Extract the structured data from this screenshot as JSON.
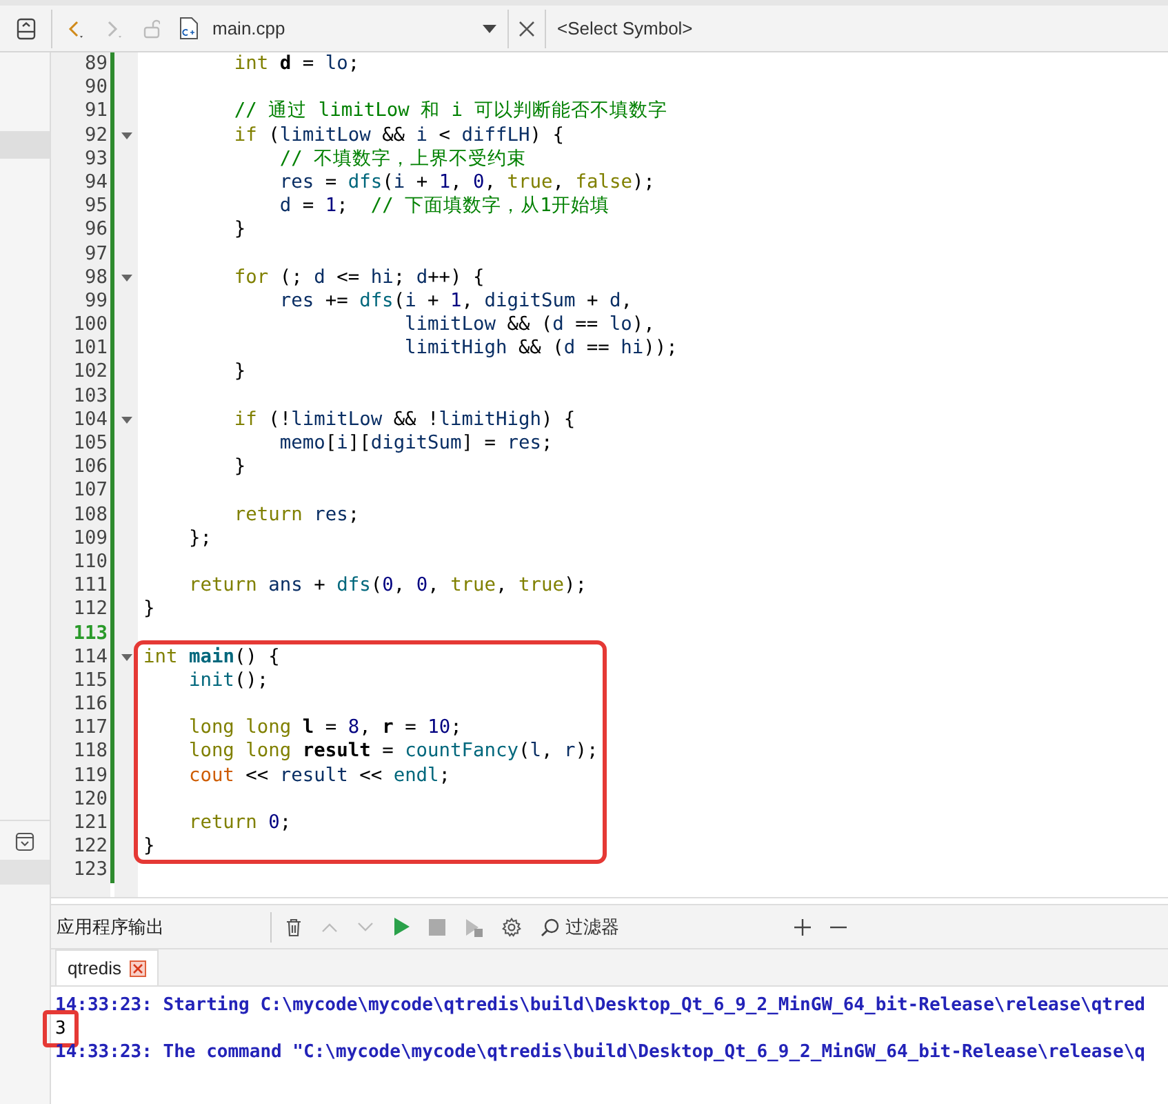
{
  "toolbar": {
    "file_name": "main.cpp",
    "symbol_placeholder": "<Select Symbol>"
  },
  "editor": {
    "lines": [
      {
        "number": "89",
        "fold": false,
        "current": false,
        "boxed": false,
        "tokens": [
          {
            "kind": "kw",
            "text": "        int "
          },
          {
            "kind": "bold",
            "text": "d"
          },
          {
            "kind": "p",
            "text": " = "
          },
          {
            "kind": "id",
            "text": "lo"
          },
          {
            "kind": "p",
            "text": ";"
          }
        ]
      },
      {
        "number": "90",
        "fold": false,
        "current": false,
        "boxed": false
      },
      {
        "number": "91",
        "fold": false,
        "current": false,
        "boxed": false,
        "tokens": [
          {
            "kind": "cmt",
            "text": "        // 通过 limitLow 和 i 可以判断能否不填数字"
          }
        ]
      },
      {
        "number": "92",
        "fold": true,
        "current": false,
        "boxed": false,
        "tokens": [
          {
            "kind": "kw",
            "text": "        if"
          },
          {
            "kind": "p",
            "text": " ("
          },
          {
            "kind": "id",
            "text": "limitLow"
          },
          {
            "kind": "p",
            "text": " && "
          },
          {
            "kind": "id",
            "text": "i"
          },
          {
            "kind": "p",
            "text": " < "
          },
          {
            "kind": "id",
            "text": "diffLH"
          },
          {
            "kind": "p",
            "text": ") {"
          }
        ]
      },
      {
        "number": "93",
        "fold": false,
        "current": false,
        "boxed": false,
        "tokens": [
          {
            "kind": "cmt",
            "text": "            // 不填数字，上界不受约束"
          }
        ]
      },
      {
        "number": "94",
        "fold": false,
        "current": false,
        "boxed": false,
        "tokens": [
          {
            "kind": "id",
            "text": "            res"
          },
          {
            "kind": "p",
            "text": " = "
          },
          {
            "kind": "fn",
            "text": "dfs"
          },
          {
            "kind": "p",
            "text": "("
          },
          {
            "kind": "id",
            "text": "i"
          },
          {
            "kind": "p",
            "text": " + "
          },
          {
            "kind": "num",
            "text": "1"
          },
          {
            "kind": "p",
            "text": ", "
          },
          {
            "kind": "num",
            "text": "0"
          },
          {
            "kind": "p",
            "text": ", "
          },
          {
            "kind": "kw",
            "text": "true"
          },
          {
            "kind": "p",
            "text": ", "
          },
          {
            "kind": "kw",
            "text": "false"
          },
          {
            "kind": "p",
            "text": ");"
          }
        ]
      },
      {
        "number": "95",
        "fold": false,
        "current": false,
        "boxed": false,
        "tokens": [
          {
            "kind": "id",
            "text": "            d"
          },
          {
            "kind": "p",
            "text": " = "
          },
          {
            "kind": "num",
            "text": "1"
          },
          {
            "kind": "p",
            "text": ";  "
          },
          {
            "kind": "cmt",
            "text": "// 下面填数字，从1开始填"
          }
        ]
      },
      {
        "number": "96",
        "fold": false,
        "current": false,
        "boxed": false,
        "tokens": [
          {
            "kind": "p",
            "text": "        }"
          }
        ]
      },
      {
        "number": "97",
        "fold": false,
        "current": false,
        "boxed": false
      },
      {
        "number": "98",
        "fold": true,
        "current": false,
        "boxed": false,
        "tokens": [
          {
            "kind": "kw",
            "text": "        for"
          },
          {
            "kind": "p",
            "text": " (; "
          },
          {
            "kind": "id",
            "text": "d"
          },
          {
            "kind": "p",
            "text": " <= "
          },
          {
            "kind": "id",
            "text": "hi"
          },
          {
            "kind": "p",
            "text": "; "
          },
          {
            "kind": "id",
            "text": "d"
          },
          {
            "kind": "p",
            "text": "++) {"
          }
        ]
      },
      {
        "number": "99",
        "fold": false,
        "current": false,
        "boxed": false,
        "tokens": [
          {
            "kind": "id",
            "text": "            res"
          },
          {
            "kind": "p",
            "text": " += "
          },
          {
            "kind": "fn",
            "text": "dfs"
          },
          {
            "kind": "p",
            "text": "("
          },
          {
            "kind": "id",
            "text": "i"
          },
          {
            "kind": "p",
            "text": " + "
          },
          {
            "kind": "num",
            "text": "1"
          },
          {
            "kind": "p",
            "text": ", "
          },
          {
            "kind": "id",
            "text": "digitSum"
          },
          {
            "kind": "p",
            "text": " + "
          },
          {
            "kind": "id",
            "text": "d"
          },
          {
            "kind": "p",
            "text": ","
          }
        ]
      },
      {
        "number": "100",
        "fold": false,
        "current": false,
        "boxed": false,
        "tokens": [
          {
            "kind": "id",
            "text": "                       limitLow"
          },
          {
            "kind": "p",
            "text": " && ("
          },
          {
            "kind": "id",
            "text": "d"
          },
          {
            "kind": "p",
            "text": " == "
          },
          {
            "kind": "id",
            "text": "lo"
          },
          {
            "kind": "p",
            "text": "),"
          }
        ]
      },
      {
        "number": "101",
        "fold": false,
        "current": false,
        "boxed": false,
        "tokens": [
          {
            "kind": "id",
            "text": "                       limitHigh"
          },
          {
            "kind": "p",
            "text": " && ("
          },
          {
            "kind": "id",
            "text": "d"
          },
          {
            "kind": "p",
            "text": " == "
          },
          {
            "kind": "id",
            "text": "hi"
          },
          {
            "kind": "p",
            "text": "));"
          }
        ]
      },
      {
        "number": "102",
        "fold": false,
        "current": false,
        "boxed": false,
        "tokens": [
          {
            "kind": "p",
            "text": "        }"
          }
        ]
      },
      {
        "number": "103",
        "fold": false,
        "current": false,
        "boxed": false
      },
      {
        "number": "104",
        "fold": true,
        "current": false,
        "boxed": false,
        "tokens": [
          {
            "kind": "kw",
            "text": "        if"
          },
          {
            "kind": "p",
            "text": " (!"
          },
          {
            "kind": "id",
            "text": "limitLow"
          },
          {
            "kind": "p",
            "text": " && !"
          },
          {
            "kind": "id",
            "text": "limitHigh"
          },
          {
            "kind": "p",
            "text": ") {"
          }
        ]
      },
      {
        "number": "105",
        "fold": false,
        "current": false,
        "boxed": false,
        "tokens": [
          {
            "kind": "id",
            "text": "            memo"
          },
          {
            "kind": "p",
            "text": "["
          },
          {
            "kind": "id",
            "text": "i"
          },
          {
            "kind": "p",
            "text": "]["
          },
          {
            "kind": "id",
            "text": "digitSum"
          },
          {
            "kind": "p",
            "text": "] = "
          },
          {
            "kind": "id",
            "text": "res"
          },
          {
            "kind": "p",
            "text": ";"
          }
        ]
      },
      {
        "number": "106",
        "fold": false,
        "current": false,
        "boxed": false,
        "tokens": [
          {
            "kind": "p",
            "text": "        }"
          }
        ]
      },
      {
        "number": "107",
        "fold": false,
        "current": false,
        "boxed": false
      },
      {
        "number": "108",
        "fold": false,
        "current": false,
        "boxed": false,
        "tokens": [
          {
            "kind": "kw",
            "text": "        return"
          },
          {
            "kind": "id",
            "text": " res"
          },
          {
            "kind": "p",
            "text": ";"
          }
        ]
      },
      {
        "number": "109",
        "fold": false,
        "current": false,
        "boxed": false,
        "tokens": [
          {
            "kind": "p",
            "text": "    };"
          }
        ]
      },
      {
        "number": "110",
        "fold": false,
        "current": false,
        "boxed": false
      },
      {
        "number": "111",
        "fold": false,
        "current": false,
        "boxed": false,
        "tokens": [
          {
            "kind": "kw",
            "text": "    return"
          },
          {
            "kind": "id",
            "text": " ans"
          },
          {
            "kind": "p",
            "text": " + "
          },
          {
            "kind": "fn",
            "text": "dfs"
          },
          {
            "kind": "p",
            "text": "("
          },
          {
            "kind": "num",
            "text": "0"
          },
          {
            "kind": "p",
            "text": ", "
          },
          {
            "kind": "num",
            "text": "0"
          },
          {
            "kind": "p",
            "text": ", "
          },
          {
            "kind": "kw",
            "text": "true"
          },
          {
            "kind": "p",
            "text": ", "
          },
          {
            "kind": "kw",
            "text": "true"
          },
          {
            "kind": "p",
            "text": ");"
          }
        ]
      },
      {
        "number": "112",
        "fold": false,
        "current": false,
        "boxed": false,
        "tokens": [
          {
            "kind": "p",
            "text": "}"
          }
        ]
      },
      {
        "number": "113",
        "fold": false,
        "current": true,
        "boxed": false
      },
      {
        "number": "114",
        "fold": true,
        "current": false,
        "boxed": true,
        "tokens": [
          {
            "kind": "kw",
            "text": "int"
          },
          {
            "kind": "fnb",
            "text": " main"
          },
          {
            "kind": "p",
            "text": "() {"
          }
        ]
      },
      {
        "number": "115",
        "fold": false,
        "current": false,
        "boxed": true,
        "tokens": [
          {
            "kind": "fn",
            "text": "    init"
          },
          {
            "kind": "p",
            "text": "();"
          }
        ]
      },
      {
        "number": "116",
        "fold": false,
        "current": false,
        "boxed": true
      },
      {
        "number": "117",
        "fold": false,
        "current": false,
        "boxed": true,
        "tokens": [
          {
            "kind": "kw",
            "text": "    long long"
          },
          {
            "kind": "bold",
            "text": " l"
          },
          {
            "kind": "p",
            "text": " = "
          },
          {
            "kind": "num",
            "text": "8"
          },
          {
            "kind": "p",
            "text": ", "
          },
          {
            "kind": "bold",
            "text": "r"
          },
          {
            "kind": "p",
            "text": " = "
          },
          {
            "kind": "num",
            "text": "10"
          },
          {
            "kind": "p",
            "text": ";"
          }
        ]
      },
      {
        "number": "118",
        "fold": false,
        "current": false,
        "boxed": true,
        "tokens": [
          {
            "kind": "kw",
            "text": "    long long"
          },
          {
            "kind": "bold",
            "text": " result"
          },
          {
            "kind": "p",
            "text": " = "
          },
          {
            "kind": "fn",
            "text": "countFancy"
          },
          {
            "kind": "p",
            "text": "("
          },
          {
            "kind": "id",
            "text": "l"
          },
          {
            "kind": "p",
            "text": ", "
          },
          {
            "kind": "id",
            "text": "r"
          },
          {
            "kind": "p",
            "text": ");"
          }
        ]
      },
      {
        "number": "119",
        "fold": false,
        "current": false,
        "boxed": true,
        "tokens": [
          {
            "kind": "glob",
            "text": "    cout"
          },
          {
            "kind": "p",
            "text": " << "
          },
          {
            "kind": "id",
            "text": "result"
          },
          {
            "kind": "p",
            "text": " << "
          },
          {
            "kind": "fn",
            "text": "endl"
          },
          {
            "kind": "p",
            "text": ";"
          }
        ]
      },
      {
        "number": "120",
        "fold": false,
        "current": false,
        "boxed": true
      },
      {
        "number": "121",
        "fold": false,
        "current": false,
        "boxed": true,
        "tokens": [
          {
            "kind": "kw",
            "text": "    return"
          },
          {
            "kind": "num",
            "text": " 0"
          },
          {
            "kind": "p",
            "text": ";"
          }
        ]
      },
      {
        "number": "122",
        "fold": false,
        "current": false,
        "boxed": true,
        "tokens": [
          {
            "kind": "p",
            "text": "}"
          }
        ]
      },
      {
        "number": "123",
        "fold": false,
        "current": false,
        "boxed": false
      }
    ]
  },
  "output_pane": {
    "title": "应用程序输出",
    "filter_placeholder": "过滤器",
    "tabs": [
      {
        "label": "qtredis",
        "selected": true
      }
    ],
    "lines": [
      {
        "kind": "system",
        "boxed": false,
        "text": "14:33:23: Starting C:\\mycode\\mycode\\qtredis\\build\\Desktop_Qt_6_9_2_MinGW_64_bit-Release\\release\\qtred"
      },
      {
        "kind": "program",
        "boxed": true,
        "text": "3"
      },
      {
        "kind": "system",
        "boxed": false,
        "text": "14:33:23: The command \"C:\\mycode\\mycode\\qtredis\\build\\Desktop_Qt_6_9_2_MinGW_64_bit-Release\\release\\q"
      }
    ]
  }
}
